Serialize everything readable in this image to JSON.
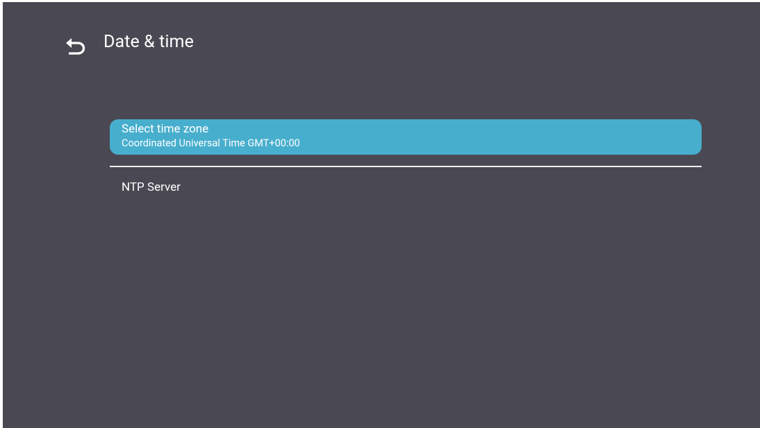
{
  "header": {
    "back_icon": "back-arrow-icon",
    "title": "Date & time"
  },
  "settings": {
    "items": [
      {
        "title": "Select time zone",
        "subtitle": "Coordinated Universal Time GMT+00:00",
        "selected": true
      },
      {
        "title": "NTP Server",
        "selected": false
      }
    ]
  },
  "colors": {
    "background": "#4a4953",
    "highlight": "#47aecd",
    "text": "#ffffff",
    "divider": "#f1f1f1"
  }
}
